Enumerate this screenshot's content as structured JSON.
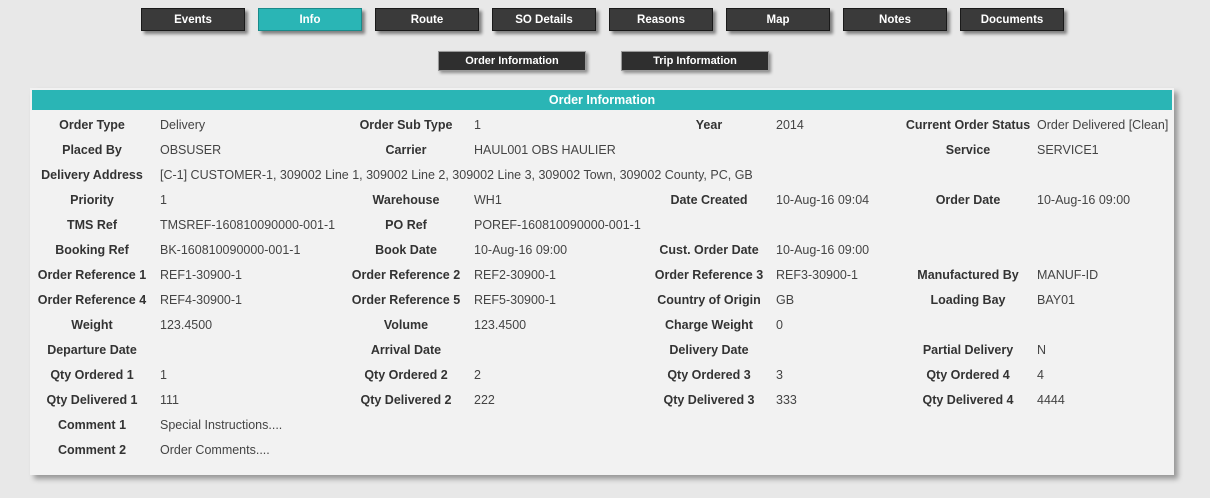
{
  "tabs": [
    "Events",
    "Info",
    "Route",
    "SO Details",
    "Reasons",
    "Map",
    "Notes",
    "Documents"
  ],
  "active_tab": "Info",
  "subtabs": [
    "Order Information",
    "Trip Information"
  ],
  "panel_title": "Order Information",
  "rows": [
    [
      [
        "Order Type",
        "Delivery"
      ],
      [
        "Order Sub Type",
        "1"
      ],
      [
        "Year",
        "2014"
      ],
      [
        "Current Order Status",
        "Order Delivered [Clean]"
      ]
    ],
    [
      [
        "Placed By",
        "OBSUSER"
      ],
      [
        "Carrier",
        "HAUL001 OBS HAULIER"
      ],
      [
        "",
        ""
      ],
      [
        "Service",
        "SERVICE1"
      ]
    ],
    [
      [
        "Delivery Address",
        "[C-1] CUSTOMER-1, 309002 Line 1, 309002 Line 2, 309002 Line 3, 309002 Town, 309002 County, PC, GB"
      ]
    ],
    [
      [
        "Priority",
        "1"
      ],
      [
        "Warehouse",
        "WH1"
      ],
      [
        "Date Created",
        "10-Aug-16 09:04"
      ],
      [
        "Order Date",
        "10-Aug-16 09:00"
      ]
    ],
    [
      [
        "TMS Ref",
        "TMSREF-160810090000-001-1"
      ],
      [
        "PO Ref",
        "POREF-160810090000-001-1"
      ],
      [
        "",
        ""
      ],
      [
        "",
        ""
      ]
    ],
    [
      [
        "Booking Ref",
        "BK-160810090000-001-1"
      ],
      [
        "Book Date",
        "10-Aug-16 09:00"
      ],
      [
        "Cust. Order Date",
        "10-Aug-16 09:00"
      ],
      [
        "",
        ""
      ]
    ],
    [
      [
        "Order Reference 1",
        "REF1-30900-1"
      ],
      [
        "Order Reference 2",
        "REF2-30900-1"
      ],
      [
        "Order Reference 3",
        "REF3-30900-1"
      ],
      [
        "Manufactured By",
        "MANUF-ID"
      ]
    ],
    [
      [
        "Order Reference 4",
        "REF4-30900-1"
      ],
      [
        "Order Reference 5",
        "REF5-30900-1"
      ],
      [
        "Country of Origin",
        "GB"
      ],
      [
        "Loading Bay",
        "BAY01"
      ]
    ],
    [
      [
        "Weight",
        "123.4500"
      ],
      [
        "Volume",
        "123.4500"
      ],
      [
        "Charge Weight",
        "0"
      ],
      [
        "",
        ""
      ]
    ],
    [
      [
        "Departure Date",
        ""
      ],
      [
        "Arrival Date",
        ""
      ],
      [
        "Delivery Date",
        ""
      ],
      [
        "Partial Delivery",
        "N"
      ]
    ],
    [
      [
        "Qty Ordered 1",
        "1"
      ],
      [
        "Qty Ordered 2",
        "2"
      ],
      [
        "Qty Ordered 3",
        "3"
      ],
      [
        "Qty Ordered 4",
        "4"
      ]
    ],
    [
      [
        "Qty Delivered 1",
        "111"
      ],
      [
        "Qty Delivered 2",
        "222"
      ],
      [
        "Qty Delivered 3",
        "333"
      ],
      [
        "Qty Delivered 4",
        "4444"
      ]
    ],
    [
      [
        "Comment 1",
        "Special Instructions...."
      ],
      [
        "",
        ""
      ],
      [
        "",
        ""
      ],
      [
        "",
        ""
      ]
    ],
    [
      [
        "Comment 2",
        "Order Comments...."
      ],
      [
        "",
        ""
      ],
      [
        "",
        ""
      ],
      [
        "",
        ""
      ]
    ]
  ],
  "colors": {
    "accent": "#2ab5b5",
    "tab_bg": "#3a3a3a",
    "panel_bg": "#f2f2f2",
    "page_bg": "#e8e8e8"
  }
}
